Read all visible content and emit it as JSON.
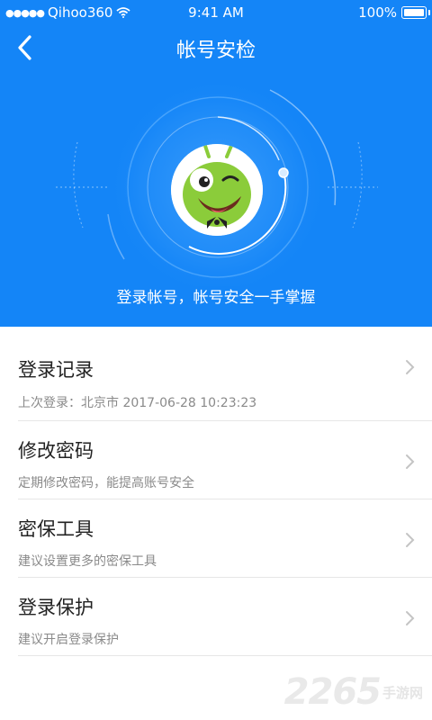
{
  "status_bar": {
    "carrier": "Qihoo360",
    "time": "9:41 AM",
    "battery": "100%"
  },
  "nav": {
    "title": "帐号安检"
  },
  "hero": {
    "tagline": "登录帐号，帐号安全一手掌握"
  },
  "items": [
    {
      "title": "登录记录",
      "subtitle": "上次登录：北京市 2017-06-28 10:23:23"
    },
    {
      "title": "修改密码",
      "subtitle": "定期修改密码，能提高账号安全"
    },
    {
      "title": "密保工具",
      "subtitle": "建议设置更多的密保工具"
    },
    {
      "title": "登录保护",
      "subtitle": "建议开启登录保护"
    }
  ],
  "watermark": {
    "number": "2265",
    "text": "手游网"
  },
  "colors": {
    "primary": "#1485f7",
    "divider": "#e6e6e6"
  }
}
